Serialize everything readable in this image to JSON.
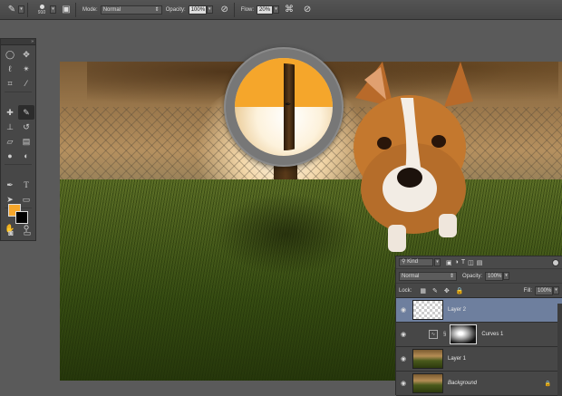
{
  "options_bar": {
    "brush_size": "910",
    "mode_label": "Mode:",
    "mode_value": "Normal",
    "opacity_label": "Opacity:",
    "opacity_value": "100%",
    "flow_label": "Flow:",
    "flow_value": "20%"
  },
  "colors": {
    "foreground": "#f5a62b",
    "background": "#000000",
    "selected_layer": "#6e7f9e"
  },
  "layers_panel": {
    "filter_kind": "Kind",
    "blend_mode": "Normal",
    "opacity_label": "Opacity:",
    "opacity_value": "100%",
    "lock_label": "Lock:",
    "fill_label": "Fill:",
    "fill_value": "100%",
    "layers": [
      {
        "name": "Layer 2",
        "selected": true
      },
      {
        "name": "Curves 1",
        "selected": false
      },
      {
        "name": "Layer 1",
        "selected": false
      },
      {
        "name": "Background",
        "selected": false,
        "locked": true
      }
    ]
  }
}
